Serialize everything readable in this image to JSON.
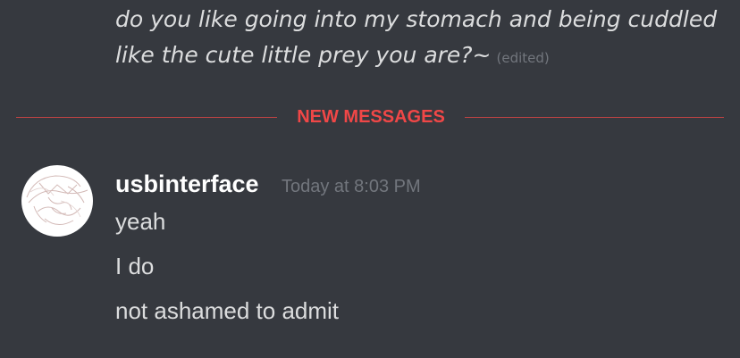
{
  "previous_message": {
    "text": "do you like going into my stomach and being cuddled like the cute little prey you are?~",
    "edited_label": "(edited)"
  },
  "divider": {
    "label": "NEW MESSAGES",
    "color": "#f04747"
  },
  "message_group": {
    "author": "usbinterface",
    "timestamp": "Today at 8:03 PM",
    "lines": [
      "yeah",
      "I do",
      "not ashamed to admit"
    ]
  },
  "theme": {
    "background": "#36393f",
    "text": "#dcddde",
    "muted": "#72767d",
    "username": "#ffffff"
  }
}
